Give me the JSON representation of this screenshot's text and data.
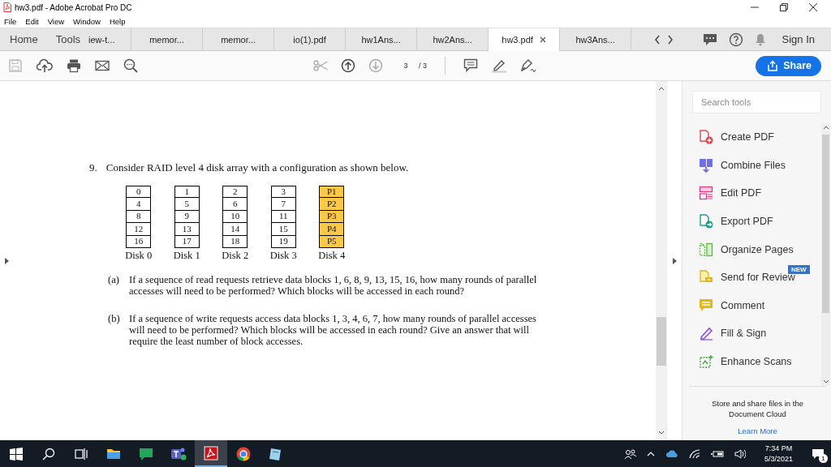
{
  "window": {
    "title": "hw3.pdf - Adobe Acrobat Pro DC"
  },
  "menu": [
    "File",
    "Edit",
    "View",
    "Window",
    "Help"
  ],
  "tabs": [
    {
      "label": "Home",
      "kind": "nav",
      "selected": false
    },
    {
      "label": "Tools",
      "kind": "nav",
      "selected": false
    },
    {
      "label": "iew-t...",
      "kind": "doc",
      "selected": false
    },
    {
      "label": "memor...",
      "kind": "doc",
      "selected": false
    },
    {
      "label": "memor...",
      "kind": "doc",
      "selected": false
    },
    {
      "label": "io(1).pdf",
      "kind": "doc",
      "selected": false
    },
    {
      "label": "hw1Ans...",
      "kind": "doc",
      "selected": false
    },
    {
      "label": "hw2Ans...",
      "kind": "doc",
      "selected": false
    },
    {
      "label": "hw3.pdf",
      "kind": "doc",
      "selected": true
    },
    {
      "label": "hw3Ans...",
      "kind": "doc",
      "selected": false
    }
  ],
  "sign_in": "Sign In",
  "toolbar": {
    "page_current": "3",
    "page_total": "/ 3",
    "share": "Share"
  },
  "document": {
    "number": "9.",
    "question": "Consider RAID level 4 disk array with a configuration as shown below.",
    "disks": [
      {
        "label": "Disk 0",
        "kind": "data",
        "blocks": [
          "0",
          "4",
          "8",
          "12",
          "16"
        ]
      },
      {
        "label": "Disk 1",
        "kind": "data",
        "blocks": [
          "1",
          "5",
          "9",
          "13",
          "17"
        ]
      },
      {
        "label": "Disk 2",
        "kind": "data",
        "blocks": [
          "2",
          "6",
          "10",
          "14",
          "18"
        ]
      },
      {
        "label": "Disk 3",
        "kind": "data",
        "blocks": [
          "3",
          "7",
          "11",
          "15",
          "19"
        ]
      },
      {
        "label": "Disk 4",
        "kind": "parity",
        "blocks": [
          "P1",
          "P2",
          "P3",
          "P4",
          "P5"
        ]
      }
    ],
    "parts": [
      {
        "marker": "(a)",
        "text": "If a sequence of read requests retrieve data blocks 1, 6, 8, 9, 13, 15, 16, how many rounds of parallel accesses will need to be performed? Which blocks will be accessed in each round?"
      },
      {
        "marker": "(b)",
        "text": "If a sequence of write requests access data blocks 1, 3, 4, 6, 7, how many rounds of parallel accesses will need to be performed? Which blocks will be accessed in each round? Give an answer that will require the least number of block accesses."
      }
    ]
  },
  "tools_panel": {
    "search": {
      "placeholder": "Search tools"
    },
    "tools": [
      {
        "label": "Create PDF",
        "kind": "create"
      },
      {
        "label": "Combine Files",
        "kind": "combine"
      },
      {
        "label": "Edit PDF",
        "kind": "edit"
      },
      {
        "label": "Export PDF",
        "kind": "export"
      },
      {
        "label": "Organize Pages",
        "kind": "organize"
      },
      {
        "label": "Send for Review",
        "kind": "review",
        "badge": "NEW"
      },
      {
        "label": "Comment",
        "kind": "comment"
      },
      {
        "label": "Fill & Sign",
        "kind": "sign"
      },
      {
        "label": "Enhance Scans",
        "kind": "enhance"
      }
    ],
    "cloud_text": "Store and share files in the Document Cloud",
    "learn_more": "Learn More"
  },
  "taskbar": {
    "apps": [
      {
        "kind": "files",
        "selected": false
      },
      {
        "kind": "chat",
        "selected": false
      },
      {
        "kind": "teams",
        "selected": false
      },
      {
        "kind": "acrobat",
        "selected": true
      },
      {
        "kind": "chrome",
        "selected": false
      },
      {
        "kind": "notepad",
        "selected": false
      }
    ],
    "time": "7:34 PM",
    "date": "5/3/2021",
    "notifications": "1"
  }
}
